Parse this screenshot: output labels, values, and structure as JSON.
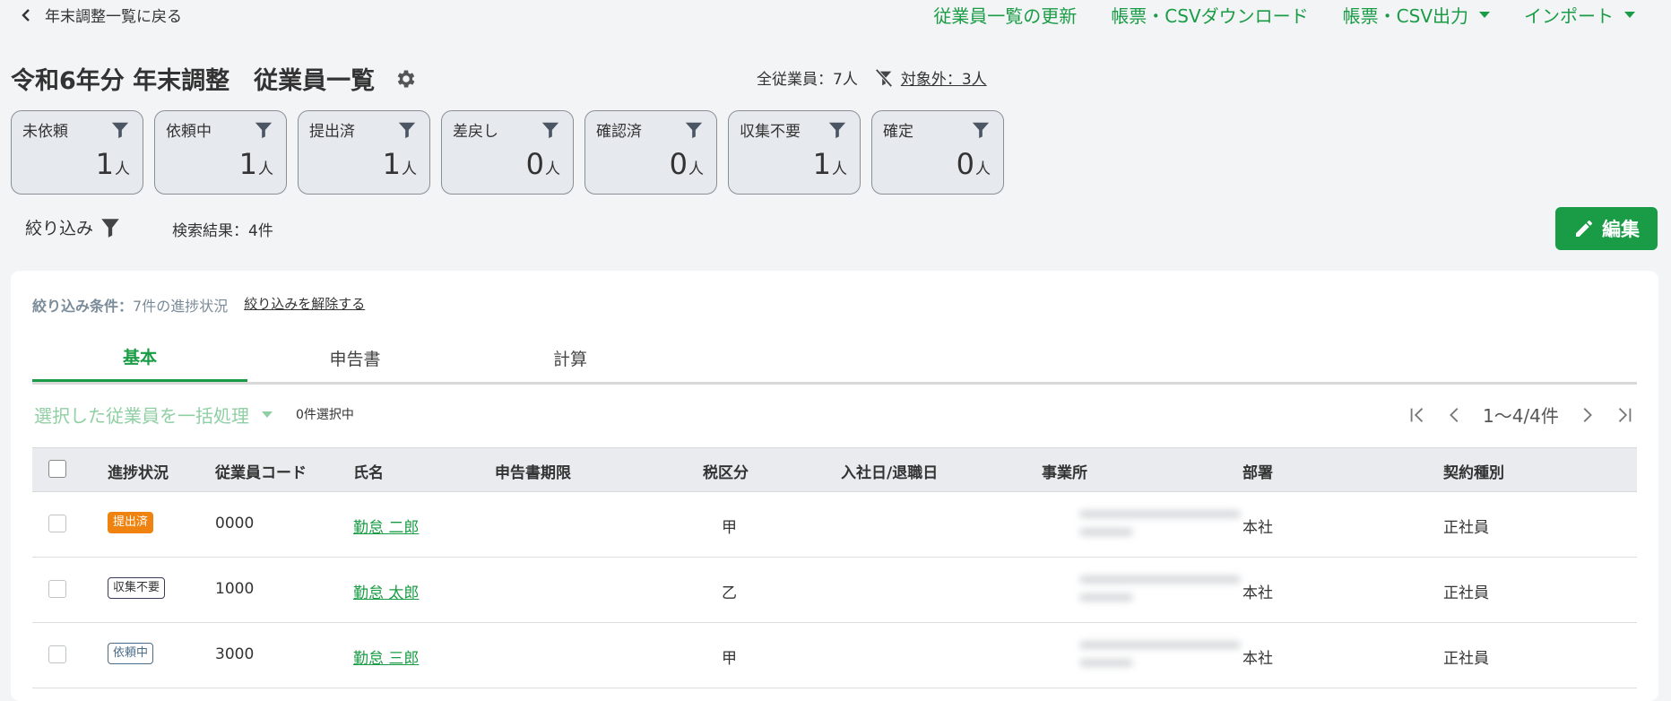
{
  "nav": {
    "back_label": "年末調整一覧に戻る",
    "refresh_label": "従業員一覧の更新",
    "download_label": "帳票・CSVダウンロード",
    "output_label": "帳票・CSV出力",
    "import_label": "インポート"
  },
  "page": {
    "title": "令和6年分 年末調整　従業員一覧",
    "total_employees": "全従業員：7人",
    "excluded": "対象外：3人"
  },
  "status_cards": [
    {
      "label": "未依頼",
      "count": "1",
      "unit": "人"
    },
    {
      "label": "依頼中",
      "count": "1",
      "unit": "人"
    },
    {
      "label": "提出済",
      "count": "1",
      "unit": "人"
    },
    {
      "label": "差戻し",
      "count": "0",
      "unit": "人"
    },
    {
      "label": "確認済",
      "count": "0",
      "unit": "人"
    },
    {
      "label": "収集不要",
      "count": "1",
      "unit": "人"
    },
    {
      "label": "確定",
      "count": "0",
      "unit": "人"
    }
  ],
  "filter": {
    "label": "絞り込み",
    "results": "検索結果：4件",
    "condition_label": "絞り込み条件：",
    "condition_value": "7件の進捗状況",
    "clear_label": "絞り込みを解除する"
  },
  "edit_label": "編集",
  "tabs": [
    "基本",
    "申告書",
    "計算"
  ],
  "bulk": {
    "label": "選択した従業員を一括処理",
    "selected": "0件選択中"
  },
  "pager": {
    "range": "1〜4/4件"
  },
  "table": {
    "headers": [
      "進捗状況",
      "従業員コード",
      "氏名",
      "申告書期限",
      "税区分",
      "入社日/退職日",
      "事業所",
      "部署",
      "契約種別"
    ],
    "rows": [
      {
        "status": "提出済",
        "code": "0000",
        "name": "勤怠 二郎",
        "tax": "甲",
        "dept": "本社",
        "contract": "正社員"
      },
      {
        "status": "収集不要",
        "code": "1000",
        "name": "勤怠 太郎",
        "tax": "乙",
        "dept": "本社",
        "contract": "正社員"
      },
      {
        "status": "依頼中",
        "code": "3000",
        "name": "勤怠 三郎",
        "tax": "甲",
        "dept": "本社",
        "contract": "正社員"
      }
    ]
  },
  "colors": {
    "accent": "#1a9c46",
    "submitted_badge": "#f0820f"
  }
}
